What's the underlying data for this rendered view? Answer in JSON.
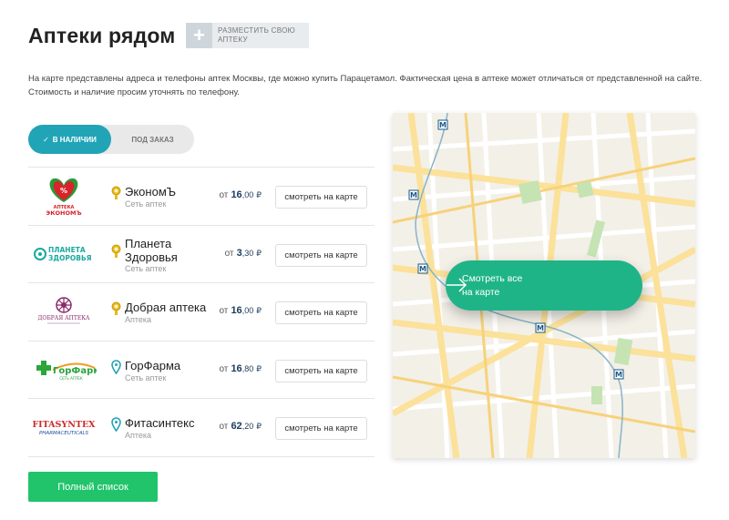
{
  "header": {
    "title": "Аптеки рядом",
    "place_button": "РАЗМЕСТИТЬ СВОЮ АПТЕКУ"
  },
  "description": "На карте представлены адреса и телефоны аптек Москвы, где можно купить Парацетамол. Фактическая цена в аптеке может отличаться от представленной на сайте. Стоимость и наличие просим уточнять по телефону.",
  "toggle": {
    "in_stock": "в наличии",
    "on_order": "под заказ"
  },
  "pharmacies": [
    {
      "name": "ЭкономЪ",
      "type": "Сеть аптек",
      "price_from": "от",
      "price_int": "16",
      "price_dec": ",00",
      "currency": "₽",
      "button": "смотреть на карте",
      "marker": "gold"
    },
    {
      "name": "Планета Здоровья",
      "type": "Сеть аптек",
      "price_from": "от",
      "price_int": "3",
      "price_dec": ",30",
      "currency": "₽",
      "button": "смотреть на карте",
      "marker": "gold"
    },
    {
      "name": "Добрая аптека",
      "type": "Аптека",
      "price_from": "от",
      "price_int": "16",
      "price_dec": ",00",
      "currency": "₽",
      "button": "смотреть на карте",
      "marker": "gold"
    },
    {
      "name": "ГорФарма",
      "type": "Сеть аптек",
      "price_from": "от",
      "price_int": "16",
      "price_dec": ",80",
      "currency": "₽",
      "button": "смотреть на карте",
      "marker": "teal"
    },
    {
      "name": "Фитасинтекс",
      "type": "Аптека",
      "price_from": "от",
      "price_int": "62",
      "price_dec": ",20",
      "currency": "₽",
      "button": "смотреть на карте",
      "marker": "teal"
    }
  ],
  "logos": {
    "ekonom": "АПТЕКА ЭКОНОМЪ",
    "planeta_1": "ПЛАНЕТА",
    "planeta_2": "ЗДОРОВЬЯ",
    "dobraya": "ДОБРАЯ АПТЕКА",
    "gorfarma_1": "ГорФарма",
    "gorfarma_2": "СЕТЬ АПТЕК",
    "fita_1": "FITASYNTEX",
    "fita_2": "PHARMACEUTICALS"
  },
  "map": {
    "cta": "Смотреть все на карте",
    "metro": "M"
  },
  "full_list_button": "Полный список",
  "colors": {
    "accent_teal": "#22a4b7",
    "cta_green": "#1fb487",
    "button_green": "#21c46a",
    "price_blue": "#1a3a5c"
  }
}
